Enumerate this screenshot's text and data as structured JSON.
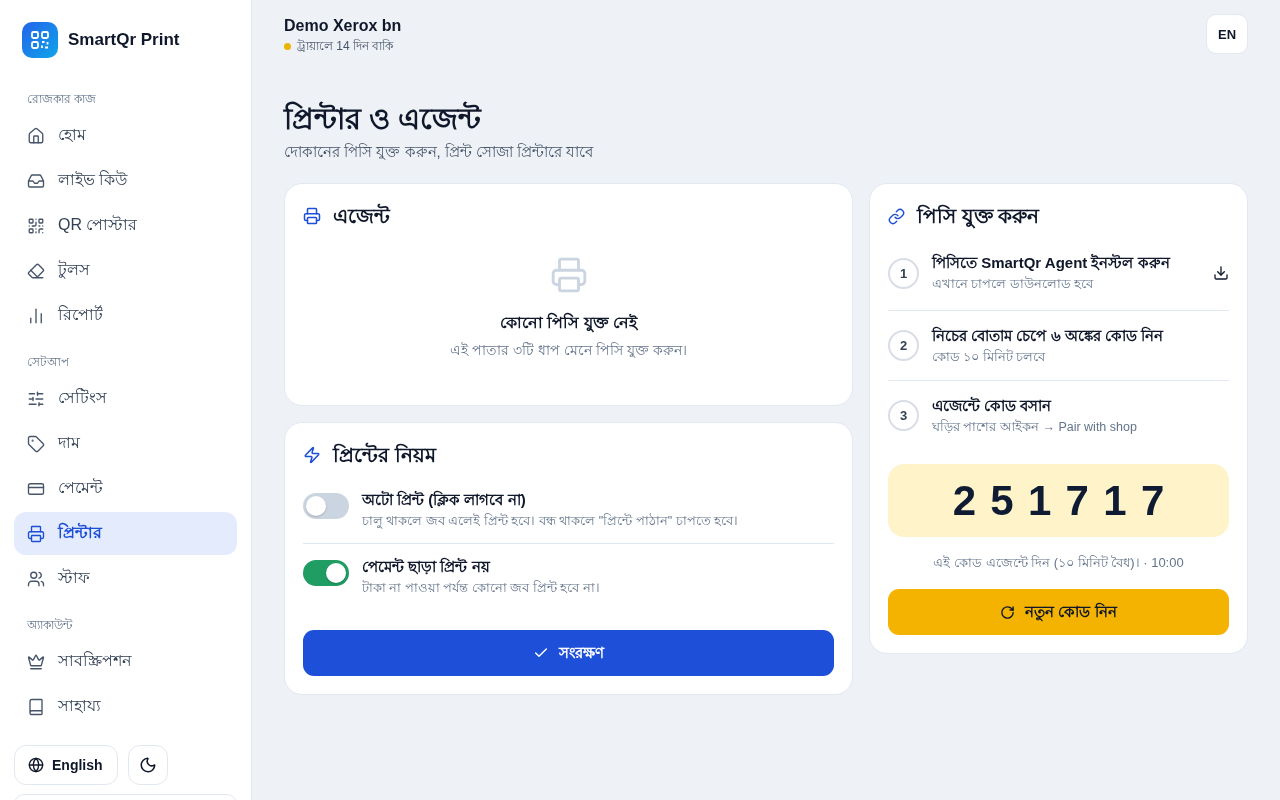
{
  "sidebar": {
    "logo": {
      "name": "SmartQr Print"
    },
    "sections": [
      {
        "title": "রোজকার কাজ",
        "items": [
          {
            "label": "হোম",
            "selected": false
          },
          {
            "label": "লাইভ কিউ",
            "selected": false
          },
          {
            "label": "QR পোস্টার",
            "selected": false
          },
          {
            "label": "টুলস",
            "selected": false
          },
          {
            "label": "রিপোর্ট",
            "selected": false
          }
        ]
      },
      {
        "title": "সেটআপ",
        "items": [
          {
            "label": "সেটিংস",
            "selected": false
          },
          {
            "label": "দাম",
            "selected": false
          },
          {
            "label": "পেমেন্ট",
            "selected": false
          },
          {
            "label": "প্রিন্টার",
            "selected": true
          },
          {
            "label": "স্টাফ",
            "selected": false
          }
        ]
      },
      {
        "title": "অ্যাকাউন্ট",
        "items": [
          {
            "label": "সাবস্ক্রিপশন",
            "selected": false
          },
          {
            "label": "সাহায্য",
            "selected": false
          }
        ]
      }
    ],
    "language_button": "English"
  },
  "header": {
    "shop_name": "Demo Xerox bn",
    "trial_status": "ট্রায়ালে 14 দিন বাকি",
    "language_button": "EN"
  },
  "page": {
    "title": "প্রিন্টার ও এজেন্ট",
    "subtitle": "দোকানের পিসি যুক্ত করুন, প্রিন্ট সোজা প্রিন্টারে যাবে"
  },
  "agent_card": {
    "title": "এজেন্ট",
    "empty_state": {
      "title": "কোনো পিসি যুক্ত নেই",
      "text": "এই পাতার ৩টি ধাপ মেনে পিসি যুক্ত করুন।"
    }
  },
  "rules_card": {
    "title": "প্রিন্টের নিয়ম",
    "rules": [
      {
        "title": "অটো প্রিন্ট (ক্লিক লাগবে না)",
        "description": "চালু থাকলে জব এলেই প্রিন্ট হবে। বন্ধ থাকলে \"প্রিন্টে পাঠান\" চাপতে হবে।",
        "on": false
      },
      {
        "title": "পেমেন্ট ছাড়া প্রিন্ট নয়",
        "description": "টাকা না পাওয়া পর্যন্ত কোনো জব প্রিন্ট হবে না।",
        "on": true
      }
    ],
    "save_button": "সংরক্ষণ"
  },
  "pair_card": {
    "title": "পিসি যুক্ত করুন",
    "steps": [
      {
        "number": "1",
        "kind": "download",
        "title": "পিসিতে SmartQr Agent ইনস্টল করুন",
        "description": "এখানে চাপলে ডাউনলোড হবে"
      },
      {
        "number": "2",
        "kind": "info",
        "title": "নিচের বোতাম চেপে ৬ অঙ্কের কোড নিন",
        "description": "কোড ১০ মিনিট চলবে"
      },
      {
        "number": "3",
        "kind": "info",
        "title": "এজেন্টে কোড বসান",
        "description": "ঘড়ির পাশের আইকন → Pair with shop"
      }
    ],
    "code": "251717",
    "note": "এই কোড এজেন্টে দিন (১০ মিনিট বৈধ)। · 10:00",
    "new_code_button": "নতুন কোড নিন"
  }
}
